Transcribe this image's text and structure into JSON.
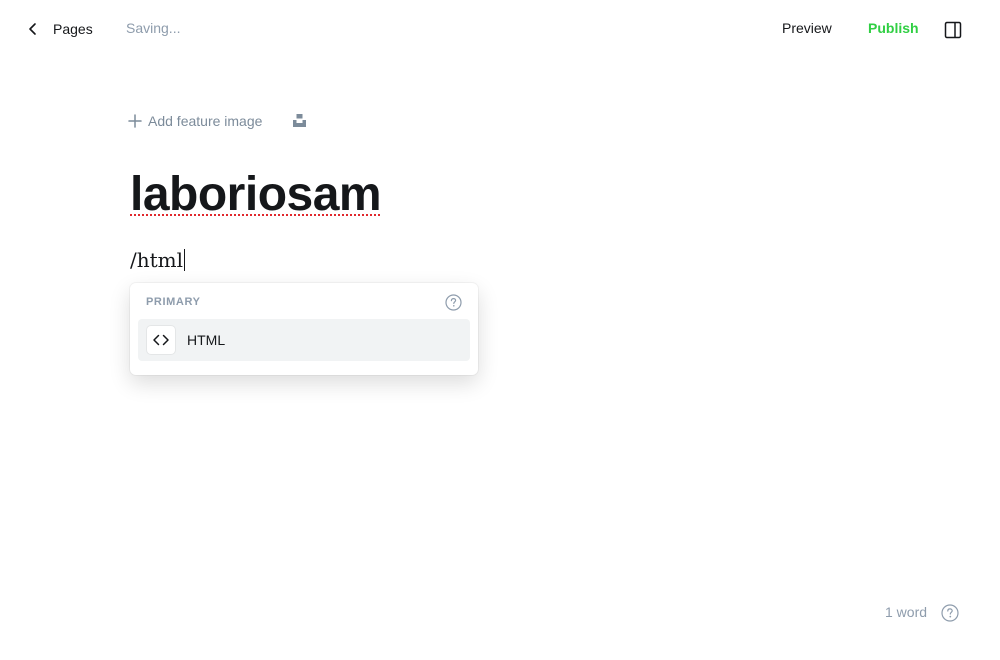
{
  "header": {
    "back_label": "Pages",
    "status": "Saving...",
    "preview_label": "Preview",
    "publish_label": "Publish",
    "panel_icon": "sidebar-toggle-icon"
  },
  "editor": {
    "feature_image_label": "Add feature image",
    "unsplash_icon": "unsplash-icon",
    "title": "laboriosam",
    "content_line": "/html"
  },
  "card_menu": {
    "section_label": "PRIMARY",
    "items": [
      {
        "label": "HTML",
        "icon": "code-icon"
      }
    ]
  },
  "footer": {
    "word_count": "1 word"
  },
  "colors": {
    "accent_green": "#30cf43",
    "muted": "#8e9cac",
    "text": "#15171a",
    "spellcheck": "#e0282d"
  }
}
